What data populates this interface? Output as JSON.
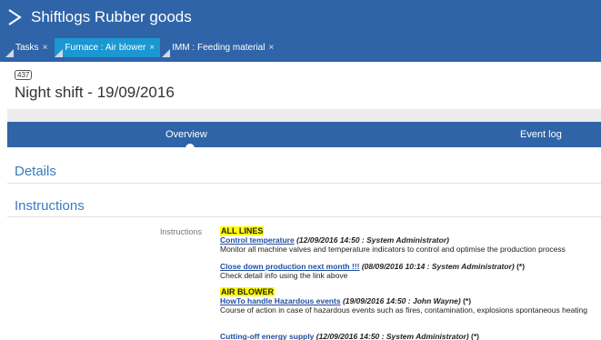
{
  "app": {
    "title": "Shiftlogs Rubber goods"
  },
  "tabs": [
    {
      "label": "Tasks",
      "close": "×"
    },
    {
      "label": "Furnace : Air blower",
      "close": "×"
    },
    {
      "label": "IMM : Feeding material",
      "close": "×"
    }
  ],
  "shift": {
    "id": "437",
    "title": "Night shift - 19/09/2016"
  },
  "nav": {
    "overview": "Overview",
    "event_log": "Event log"
  },
  "sections": {
    "details": "Details",
    "instructions": "Instructions"
  },
  "instructions": {
    "label": "Instructions",
    "groups": [
      {
        "tag": "ALL LINES",
        "items": [
          {
            "link": "Control temperature",
            "meta": "(12/09/2016 14:50 : System Administrator)",
            "star": "",
            "desc": "Monitor all machine valves and temperature indicators to control and optimise the production process"
          },
          {
            "link": "Close down production next month !!!",
            "meta": "(08/09/2016 10:14 : System Administrator)",
            "star": "(*)",
            "desc": "Check detail info using the link above"
          }
        ]
      },
      {
        "tag": "AIR BLOWER",
        "items": [
          {
            "link": "HowTo handle Hazardous events",
            "meta": "(19/09/2016 14:50 : John Wayne)",
            "star": "(*)",
            "desc": "Course of action in case of hazardous events such as fires, contamination, explosions spontaneous heating"
          },
          {
            "link": "Cutting-off energy supply",
            "meta": "(12/09/2016 14:50 : System Administrator)",
            "star": "(*)",
            "desc": ""
          }
        ]
      }
    ]
  },
  "colors": {
    "header_blue": "#2f64a8",
    "active_tab": "#1b97d2",
    "section_text": "#3a7bbf",
    "highlight": "#ffff00"
  }
}
